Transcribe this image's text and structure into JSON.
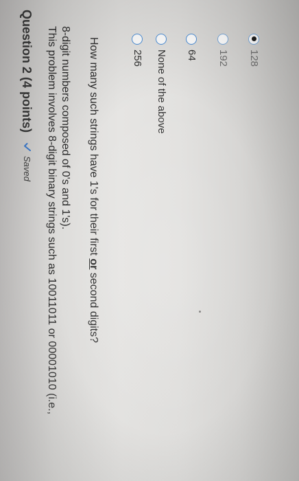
{
  "question": {
    "title": "Question 2 (4 points)",
    "saved_label": "Saved",
    "prompt_line1": "This problem involves 8-digit binary strings such as 10011011 or 00001010 (i.e.,",
    "prompt_line2": "8-digit numbers composed of 0's and 1's).",
    "ask_before": "How many such strings have 1's for their first ",
    "ask_emphasis": "or",
    "ask_after": " second digits?"
  },
  "options": [
    {
      "label": "256",
      "selected": false
    },
    {
      "label": "None of the above",
      "selected": false
    },
    {
      "label": "64",
      "selected": false
    },
    {
      "label": "192",
      "selected": false
    },
    {
      "label": "128",
      "selected": true
    }
  ],
  "colors": {
    "radio_border": "#4b8fd9",
    "text": "#2e2e2e"
  }
}
